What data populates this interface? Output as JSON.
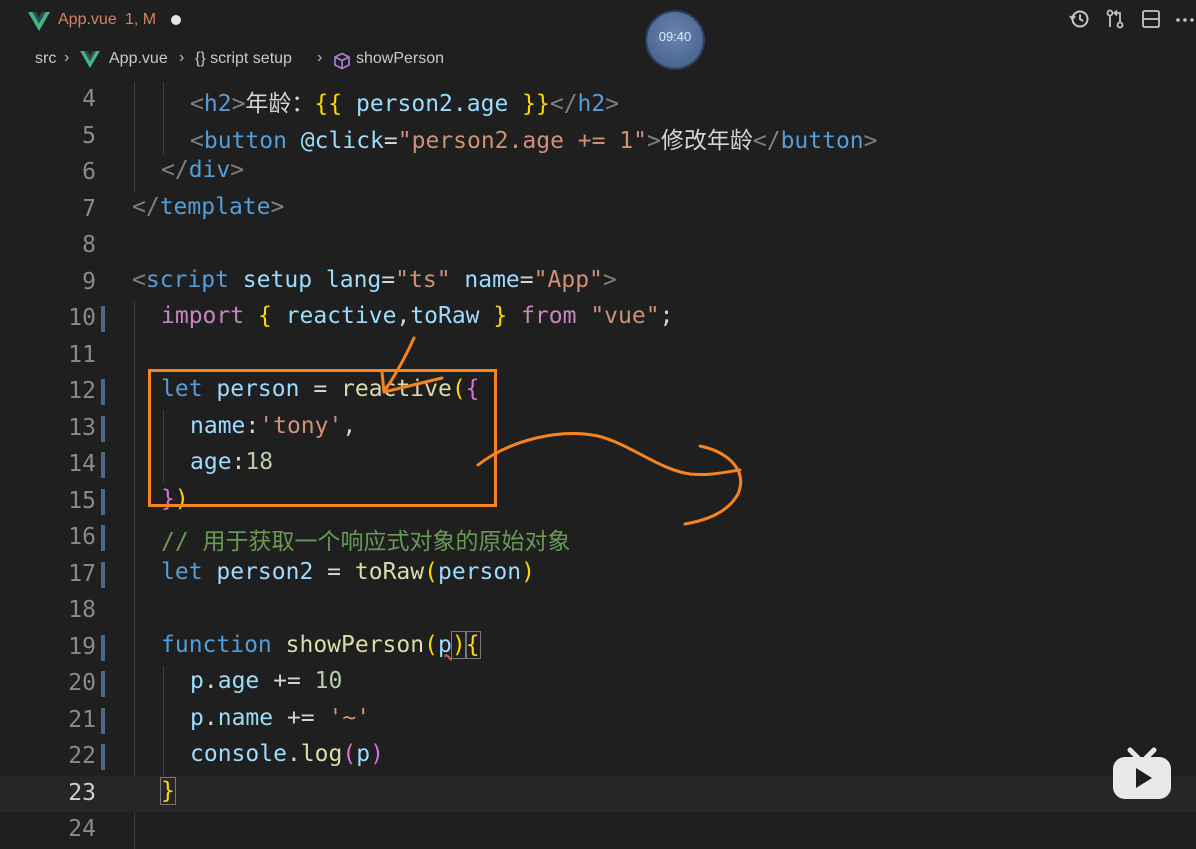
{
  "tab": {
    "title": "App.vue",
    "status": "1, M"
  },
  "timer": "09:40",
  "breadcrumb": {
    "items": [
      "src",
      "App.vue",
      "{} script setup",
      "showPerson"
    ]
  },
  "lines": [
    {
      "n": "4"
    },
    {
      "n": "5"
    },
    {
      "n": "6"
    },
    {
      "n": "7"
    },
    {
      "n": "8"
    },
    {
      "n": "9"
    },
    {
      "n": "10"
    },
    {
      "n": "11"
    },
    {
      "n": "12"
    },
    {
      "n": "13"
    },
    {
      "n": "14"
    },
    {
      "n": "15"
    },
    {
      "n": "16"
    },
    {
      "n": "17"
    },
    {
      "n": "18"
    },
    {
      "n": "19"
    },
    {
      "n": "20"
    },
    {
      "n": "21"
    },
    {
      "n": "22"
    },
    {
      "n": "23"
    },
    {
      "n": "24"
    }
  ],
  "code": {
    "l4": {
      "t1": "<",
      "tag": "h2",
      "t2": ">",
      "text": "年龄：",
      "m1": "{{ ",
      "expr": "person2.age",
      "m2": " }}",
      "t3": "</",
      "tag2": "h2",
      "t4": ">"
    },
    "l5": {
      "t1": "<",
      "tag": "button",
      "attr": " @click",
      "eq": "=",
      "val": "\"person2.age += 1\"",
      "t2": ">",
      "text": "修改年龄",
      "t3": "</",
      "tag2": "button",
      "t4": ">"
    },
    "l6": {
      "t1": "</",
      "tag": "div",
      "t2": ">"
    },
    "l7": {
      "t1": "</",
      "tag": "template",
      "t2": ">"
    },
    "l9": {
      "t1": "<",
      "tag": "script",
      "a1": " setup",
      "a2": " lang",
      "eq1": "=",
      "v1": "\"ts\"",
      "a3": " name",
      "eq2": "=",
      "v2": "\"App\"",
      "t2": ">"
    },
    "l10": {
      "kw": "import",
      "b1": " { ",
      "v1": "reactive",
      "c": ",",
      "v2": "toRaw",
      "b2": " } ",
      "kw2": "from",
      "sp": " ",
      "str": "\"vue\"",
      "semi": ";"
    },
    "l12": {
      "kw": "let",
      "v": " person",
      "op": " = ",
      "fn": "reactive",
      "p": "(",
      "b": "{"
    },
    "l13": {
      "k": "name",
      "c": ":",
      "s": "'tony'",
      "cm": ","
    },
    "l14": {
      "k": "age",
      "c": ":",
      "n": "18"
    },
    "l15": {
      "b": "}",
      "p": ")"
    },
    "l16": {
      "cmt": "// 用于获取一个响应式对象的原始对象"
    },
    "l17": {
      "kw": "let",
      "v": " person2",
      "op": " = ",
      "fn": "toRaw",
      "p1": "(",
      "a": "person",
      "p2": ")"
    },
    "l19": {
      "kw": "function",
      "fn": " showPerson",
      "p1": "(",
      "a": "p",
      "p2": ")",
      "b": "{"
    },
    "l20": {
      "a": "p",
      "d": ".",
      "k": "age",
      "op": " += ",
      "n": "10"
    },
    "l21": {
      "a": "p",
      "d": ".",
      "k": "name",
      "op": " += ",
      "s": "'~'"
    },
    "l22": {
      "a": "console",
      "d": ".",
      "fn": "log",
      "p1": "(",
      "v": "p",
      "p2": ")"
    },
    "l23": {
      "b": "}"
    }
  },
  "colors": {
    "accent": "#f5831f",
    "vue": "#41b883",
    "tab_modified": "#d58262"
  }
}
